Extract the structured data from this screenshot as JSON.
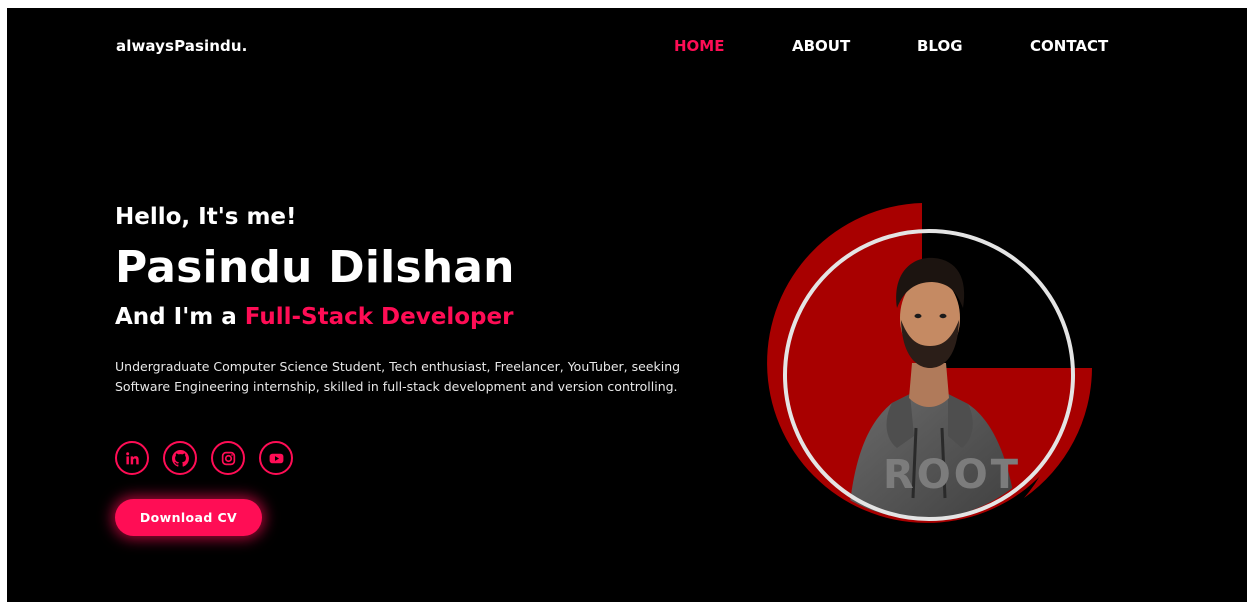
{
  "brand": {
    "logo_text": "alwaysPasindu."
  },
  "nav": {
    "items": [
      {
        "label": "HOME",
        "active": true
      },
      {
        "label": "ABOUT",
        "active": false
      },
      {
        "label": "BLOG",
        "active": false
      },
      {
        "label": "CONTACT",
        "active": false
      }
    ]
  },
  "hero": {
    "greeting": "Hello, It's me!",
    "name": "Pasindu Dilshan",
    "role_prefix": "And I'm a",
    "role_highlight": "Full-Stack Developer",
    "description": "Undergraduate Computer Science Student, Tech enthusiast, Freelancer, YouTuber, seeking Software Engineering internship, skilled in full-stack development and version controlling.",
    "cta_label": "Download CV"
  },
  "socials": [
    {
      "icon": "linkedin-icon"
    },
    {
      "icon": "github-icon"
    },
    {
      "icon": "instagram-icon"
    },
    {
      "icon": "youtube-icon"
    }
  ],
  "colors": {
    "background": "#000000",
    "accent": "#ff0d55",
    "shape_red": "#a80000",
    "text": "#ffffff"
  }
}
